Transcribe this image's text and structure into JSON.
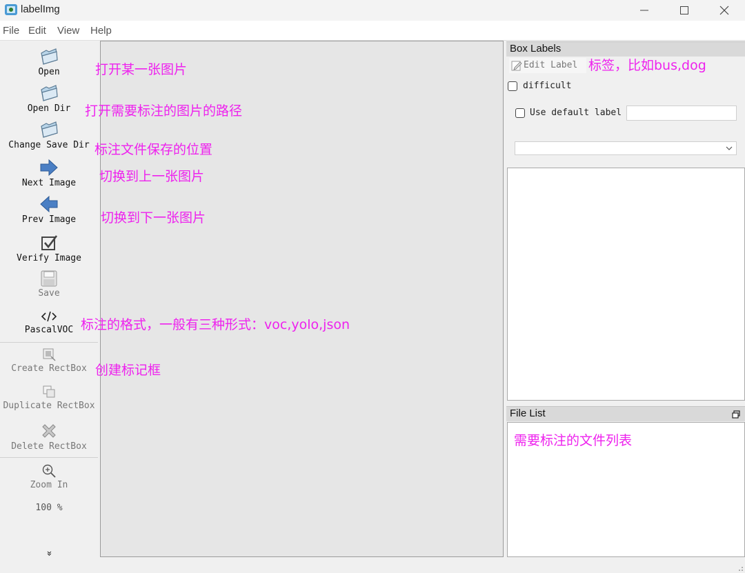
{
  "window": {
    "title": "labelImg"
  },
  "menu": [
    "File",
    "Edit",
    "View",
    "Help"
  ],
  "toolbar": {
    "items": [
      {
        "label": "Open",
        "icon": "folder-icon",
        "enabled": true
      },
      {
        "label": "Open Dir",
        "icon": "folder-icon",
        "enabled": true
      },
      {
        "label": "Change Save Dir",
        "icon": "folder-icon",
        "enabled": true
      },
      {
        "label": "Next Image",
        "icon": "arrow-right-icon",
        "enabled": true
      },
      {
        "label": "Prev Image",
        "icon": "arrow-left-icon",
        "enabled": true
      },
      {
        "label": "Verify Image",
        "icon": "verify-check-icon",
        "enabled": true
      },
      {
        "label": "Save",
        "icon": "save-icon",
        "enabled": false
      },
      {
        "label": "PascalVOC",
        "icon": "code-icon",
        "enabled": true
      },
      {
        "label": "Create RectBox",
        "icon": "create-rectbox-icon",
        "enabled": false
      },
      {
        "label": "Duplicate RectBox",
        "icon": "duplicate-icon",
        "enabled": false
      },
      {
        "label": "Delete RectBox",
        "icon": "delete-icon",
        "enabled": false
      },
      {
        "label": "Zoom In",
        "icon": "zoom-in-icon",
        "enabled": false
      }
    ],
    "zoom_value": "100 %",
    "more_glyph": "»"
  },
  "box_labels": {
    "title": "Box Labels",
    "edit_label": "Edit Label",
    "difficult": "difficult",
    "use_default_label": "Use default label",
    "default_label_value": "",
    "dropdown_value": ""
  },
  "file_list": {
    "title": "File List"
  },
  "annotations": {
    "open": "打开某一张图片",
    "open_dir": "打开需要标注的图片的路径",
    "change_save_dir": "标注文件保存的位置",
    "next_image": "切换到上一张图片",
    "prev_image": "切换到下一张图片",
    "format": "标注的格式，一般有三种形式：voc,yolo,json",
    "create_rectbox": "创建标记框",
    "label": "标签，比如bus,dog",
    "file_list": "需要标注的文件列表"
  },
  "colors": {
    "annotation": "#ee22ee",
    "canvas": "#e6e6e6"
  }
}
